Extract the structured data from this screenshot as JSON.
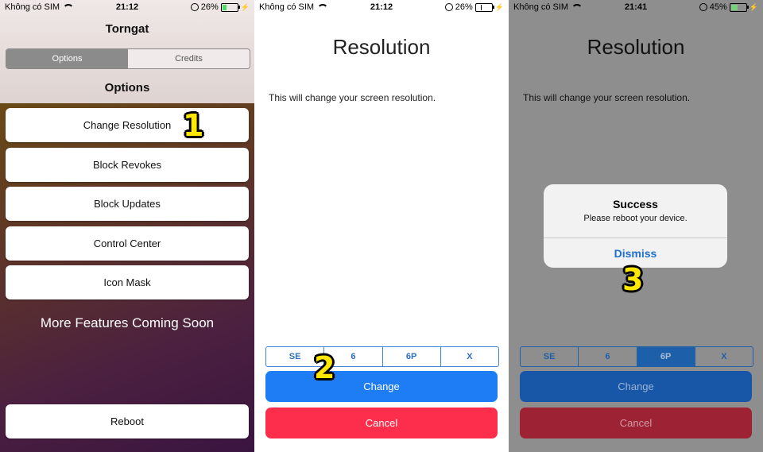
{
  "status_bars": [
    {
      "carrier": "Không có SIM",
      "time": "21:12",
      "battery": "26%",
      "battery_level": 0.26
    },
    {
      "carrier": "Không có SIM",
      "time": "21:12",
      "battery": "26%",
      "battery_level": 0.26
    },
    {
      "carrier": "Không có SIM",
      "time": "21:41",
      "battery": "45%",
      "battery_level": 0.45
    }
  ],
  "screen1": {
    "title": "Torngat",
    "segments": [
      "Options",
      "Credits"
    ],
    "selected_segment": "Options",
    "section_title": "Options",
    "options": [
      "Change Resolution",
      "Block Revokes",
      "Block Updates",
      "Control Center",
      "Icon Mask"
    ],
    "coming_soon": "More Features Coming Soon",
    "reboot_label": "Reboot"
  },
  "screen2": {
    "title": "Resolution",
    "description": "This will change your screen resolution.",
    "resolutions": [
      "SE",
      "6",
      "6P",
      "X"
    ],
    "change_label": "Change",
    "cancel_label": "Cancel"
  },
  "screen3": {
    "title": "Resolution",
    "description": "This will change your screen resolution.",
    "resolutions": [
      "SE",
      "6",
      "6P",
      "X"
    ],
    "selected_resolution": "6P",
    "change_label": "Change",
    "cancel_label": "Cancel",
    "alert": {
      "title": "Success",
      "message": "Please reboot your device.",
      "dismiss_label": "Dismiss"
    }
  },
  "step_labels": [
    "1",
    "2",
    "3"
  ],
  "colors": {
    "accent_blue": "#1e7cf4",
    "cancel_red": "#fc2e4c",
    "step_yellow": "#ffe800"
  }
}
